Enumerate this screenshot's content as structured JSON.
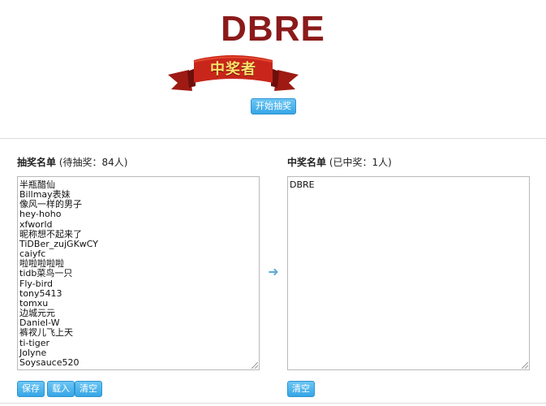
{
  "winner_display": "DBRE",
  "banner_text": "中奖者",
  "start_button": "开始抽奖",
  "left_panel": {
    "title_bold": "抽奖名单",
    "title_count": "(待抽奖：84人)",
    "candidates": [
      "半瓶醋仙",
      "Billmay表妹",
      "像风一样的男子",
      "hey-hoho",
      "xfworld",
      "昵称想不起来了",
      "TiDBer_zujGKwCY",
      "caiyfc",
      "啦啦啦啦啦",
      "tidb菜鸟一只",
      "Fly-bird",
      "tony5413",
      "tomxu",
      "边城元元",
      "Daniel-W",
      "裤衩儿飞上天",
      "ti-tiger",
      "Jolyne",
      "Soysauce520"
    ],
    "save_label": "保存",
    "load_label": "载入",
    "clear_label": "清空"
  },
  "right_panel": {
    "title_bold": "中奖名单",
    "title_count": "(已中奖：1人)",
    "winners": [
      "DBRE"
    ],
    "clear_label": "清空"
  },
  "colors": {
    "accent_button": "#37a6e6",
    "winner_text": "#8b1a1a",
    "ribbon_red": "#c8261b",
    "ribbon_text": "#ffe26b"
  },
  "icons": {
    "transfer_arrow": "arrow-right-icon"
  }
}
